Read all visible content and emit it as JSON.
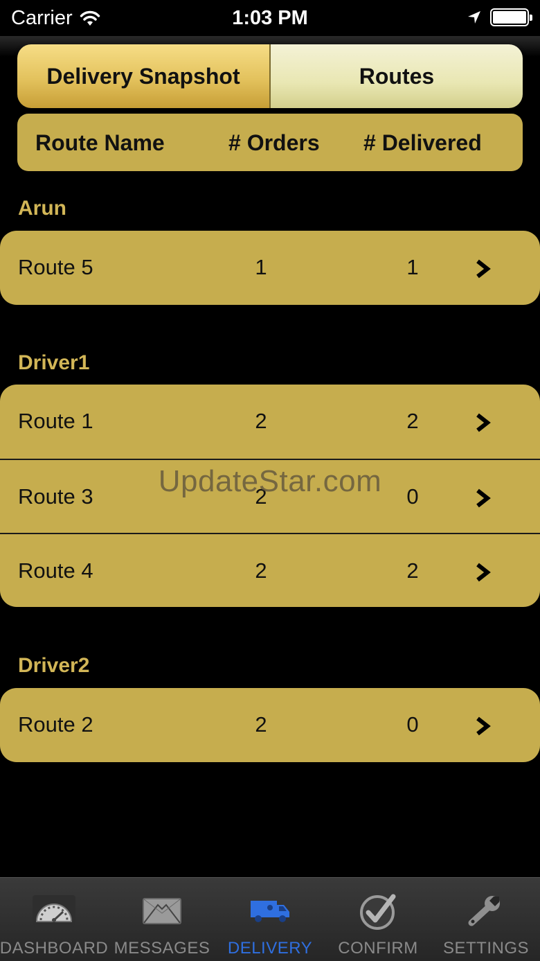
{
  "status_bar": {
    "carrier": "Carrier",
    "time": "1:03 PM"
  },
  "segmented": {
    "active_label": "Delivery Snapshot",
    "inactive_label": "Routes"
  },
  "column_headers": {
    "name": "Route Name",
    "orders": "# Orders",
    "delivered": "# Delivered"
  },
  "sections": [
    {
      "title": "Arun",
      "rows": [
        {
          "name": "Route 5",
          "orders": "1",
          "delivered": "1"
        }
      ]
    },
    {
      "title": "Driver1",
      "rows": [
        {
          "name": "Route 1",
          "orders": "2",
          "delivered": "2"
        },
        {
          "name": "Route 3",
          "orders": "2",
          "delivered": "0"
        },
        {
          "name": "Route 4",
          "orders": "2",
          "delivered": "2"
        }
      ]
    },
    {
      "title": "Driver2",
      "rows": [
        {
          "name": "Route 2",
          "orders": "2",
          "delivered": "0"
        }
      ]
    }
  ],
  "watermark": "UpdateStar.com",
  "tabs": [
    {
      "label": "DASHBOARD",
      "icon": "speedometer-icon"
    },
    {
      "label": "MESSAGES",
      "icon": "envelope-icon"
    },
    {
      "label": "DELIVERY",
      "icon": "delivery-truck-icon",
      "active": true
    },
    {
      "label": "CONFIRM",
      "icon": "checkmark-icon"
    },
    {
      "label": "SETTINGS",
      "icon": "wrench-icon"
    }
  ],
  "colors": {
    "gold": "#c6ad4e",
    "section_title": "#d2b657",
    "active_tab": "#2f6fe0"
  }
}
